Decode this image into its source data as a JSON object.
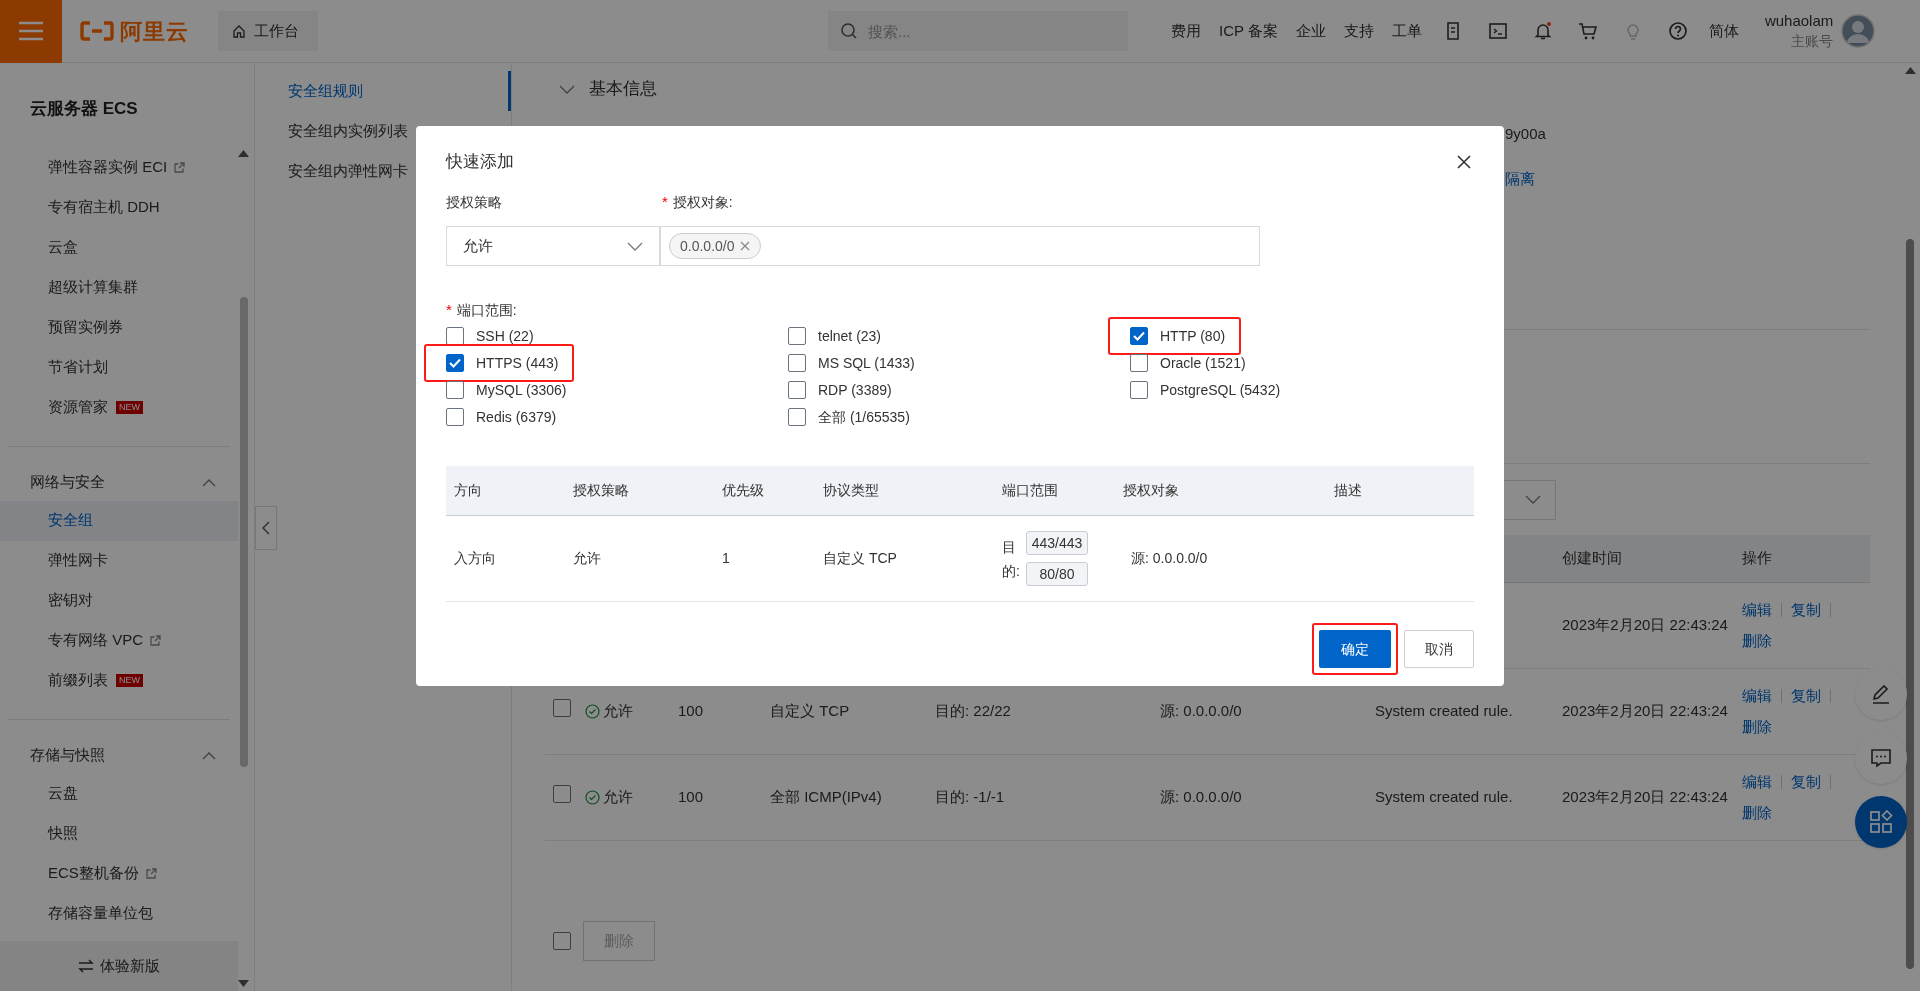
{
  "topbar": {
    "brand": "阿里云",
    "workbench": "工作台",
    "search_placeholder": "搜索...",
    "nav": [
      "费用",
      "ICP 备案",
      "企业",
      "支持",
      "工单"
    ],
    "language": "简体",
    "username": "wuhaolam",
    "account_type": "主账号"
  },
  "sidebar": {
    "title": "云服务器 ECS",
    "sections": [
      {
        "items": [
          {
            "label": "弹性容器实例 ECI",
            "external": true,
            "selected": false
          },
          {
            "label": "专有宿主机 DDH",
            "external": false,
            "selected": false
          },
          {
            "label": "云盒",
            "external": false,
            "selected": false
          },
          {
            "label": "超级计算集群",
            "external": false,
            "selected": false
          },
          {
            "label": "预留实例券",
            "external": false,
            "selected": false
          },
          {
            "label": "节省计划",
            "external": false,
            "selected": false
          },
          {
            "label": "资源管家",
            "external": false,
            "badge": "NEW",
            "selected": false
          }
        ]
      },
      {
        "header": "网络与安全",
        "expanded": true,
        "items": [
          {
            "label": "安全组",
            "external": false,
            "selected": true
          },
          {
            "label": "弹性网卡",
            "external": false,
            "selected": false
          },
          {
            "label": "密钥对",
            "external": false,
            "selected": false
          },
          {
            "label": "专有网络 VPC",
            "external": true,
            "selected": false
          },
          {
            "label": "前缀列表",
            "external": false,
            "badge": "NEW",
            "selected": false
          }
        ]
      },
      {
        "header": "存储与快照",
        "expanded": true,
        "items": [
          {
            "label": "云盘",
            "external": false,
            "selected": false
          },
          {
            "label": "快照",
            "external": false,
            "selected": false
          },
          {
            "label": "ECS整机备份",
            "external": true,
            "selected": false
          },
          {
            "label": "存储容量单位包",
            "external": false,
            "selected": false
          }
        ]
      }
    ],
    "footer_action": "体验新版"
  },
  "subnav": [
    {
      "label": "安全组规则",
      "selected": true
    },
    {
      "label": "安全组内实例列表",
      "selected": false
    },
    {
      "label": "安全组内弹性网卡",
      "selected": false
    }
  ],
  "main": {
    "section_title": "基本信息",
    "fragments": [
      {
        "text": "9y00a",
        "kind": "value"
      },
      {
        "text": "隔离",
        "kind": "link"
      }
    ],
    "rules_table": {
      "columns": [
        "创建时间",
        "操作"
      ],
      "rows": [
        {
          "created": "2023年2月20日 22:43:24",
          "actions": [
            "编辑",
            "复制",
            "删除"
          ]
        },
        {
          "checked": false,
          "policy": "允许",
          "priority": "100",
          "protocol": "自定义 TCP",
          "port": "目的: 22/22",
          "source": "源: 0.0.0.0/0",
          "description": "System created rule.",
          "created": "2023年2月20日 22:43:24",
          "actions": [
            "编辑",
            "复制",
            "删除"
          ]
        },
        {
          "checked": false,
          "policy": "允许",
          "priority": "100",
          "protocol": "全部 ICMP(IPv4)",
          "port": "目的: -1/-1",
          "source": "源: 0.0.0.0/0",
          "description": "System created rule.",
          "created": "2023年2月20日 22:43:24",
          "actions": [
            "编辑",
            "复制",
            "删除"
          ]
        }
      ],
      "select_all_checked": false,
      "delete_button": "删除"
    }
  },
  "dialog": {
    "title": "快速添加",
    "policy_label": "授权策略",
    "policy_value": "允许",
    "target_required_mark": "*",
    "target_label": "授权对象:",
    "target_tags": [
      "0.0.0.0/0"
    ],
    "ports_required_mark": "*",
    "ports_label": "端口范围:",
    "ports": [
      {
        "label": "SSH (22)",
        "checked": false,
        "highlighted": false
      },
      {
        "label": "telnet (23)",
        "checked": false,
        "highlighted": false
      },
      {
        "label": "HTTP (80)",
        "checked": true,
        "highlighted": true
      },
      {
        "label": "HTTPS (443)",
        "checked": true,
        "highlighted": true
      },
      {
        "label": "MS SQL (1433)",
        "checked": false,
        "highlighted": false
      },
      {
        "label": "Oracle (1521)",
        "checked": false,
        "highlighted": false
      },
      {
        "label": "MySQL (3306)",
        "checked": false,
        "highlighted": false
      },
      {
        "label": "RDP (3389)",
        "checked": false,
        "highlighted": false
      },
      {
        "label": "PostgreSQL (5432)",
        "checked": false,
        "highlighted": false
      },
      {
        "label": "Redis (6379)",
        "checked": false,
        "highlighted": false
      },
      {
        "label": "全部 (1/65535)",
        "checked": false,
        "highlighted": false
      }
    ],
    "preview": {
      "columns": [
        "方向",
        "授权策略",
        "优先级",
        "协议类型",
        "端口范围",
        "授权对象",
        "描述"
      ],
      "rows": [
        {
          "direction": "入方向",
          "policy": "允许",
          "priority": "1",
          "protocol": "自定义 TCP",
          "port_prefix": "目的:",
          "ports": [
            "443/443",
            "80/80"
          ],
          "target": "源: 0.0.0.0/0"
        }
      ]
    },
    "ok_button": {
      "label": "确定",
      "highlighted": true
    },
    "cancel_button": "取消"
  }
}
